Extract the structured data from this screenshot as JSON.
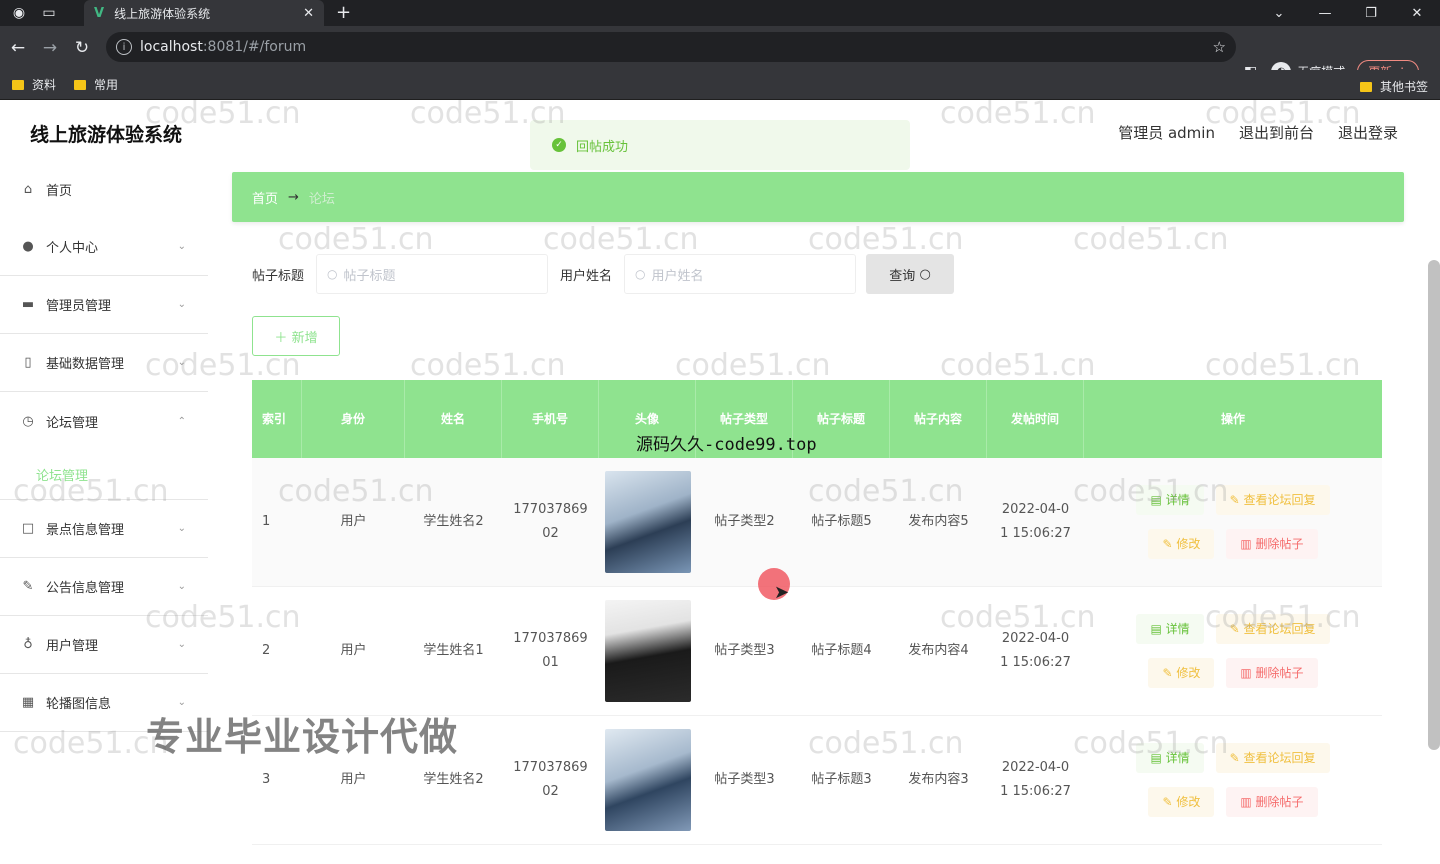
{
  "browser": {
    "tab_title": "线上旅游体验系统",
    "url_host": "localhost",
    "url_rest": ":8081/#/forum",
    "incognito_label": "无痕模式",
    "update_label": "更新",
    "bookmarks": [
      "资料",
      "常用"
    ],
    "other_bookmarks": "其他书签"
  },
  "app": {
    "title": "线上旅游体验系统",
    "user_label": "管理员 admin",
    "back_front": "退出到前台",
    "logout": "退出登录",
    "toast": "回帖成功"
  },
  "sidebar": {
    "items": [
      {
        "label": "首页",
        "icon": "home-icon"
      },
      {
        "label": "个人中心",
        "icon": "user-icon"
      },
      {
        "label": "管理员管理",
        "icon": "admin-icon"
      },
      {
        "label": "基础数据管理",
        "icon": "data-icon"
      },
      {
        "label": "论坛管理",
        "icon": "forum-icon"
      },
      {
        "label": "景点信息管理",
        "icon": "scenic-icon"
      },
      {
        "label": "公告信息管理",
        "icon": "notice-icon"
      },
      {
        "label": "用户管理",
        "icon": "users-icon"
      },
      {
        "label": "轮播图信息",
        "icon": "carousel-icon"
      }
    ],
    "sub_forum": "论坛管理"
  },
  "breadcrumb": {
    "home": "首页",
    "sep": "→",
    "current": "论坛"
  },
  "search": {
    "title_label": "帖子标题",
    "title_placeholder": "帖子标题",
    "user_label": "用户姓名",
    "user_placeholder": "用户姓名",
    "query_button": "查询"
  },
  "add_button": "新增",
  "table": {
    "headers": [
      "索引",
      "身份",
      "姓名",
      "手机号",
      "头像",
      "帖子类型",
      "帖子标题",
      "帖子内容",
      "发帖时间",
      "操作"
    ],
    "rows": [
      {
        "index": "1",
        "role": "用户",
        "name": "学生姓名2",
        "phone": "17703786902",
        "phone_a": "177037869",
        "phone_b": "02",
        "type": "帖子类型2",
        "title": "帖子标题5",
        "content": "发布内容5",
        "time_a": "2022-04-0",
        "time_b": "1 15:06:27"
      },
      {
        "index": "2",
        "role": "用户",
        "name": "学生姓名1",
        "phone": "17703786901",
        "phone_a": "177037869",
        "phone_b": "01",
        "type": "帖子类型3",
        "title": "帖子标题4",
        "content": "发布内容4",
        "time_a": "2022-04-0",
        "time_b": "1 15:06:27"
      },
      {
        "index": "3",
        "role": "用户",
        "name": "学生姓名2",
        "phone": "17703786902",
        "phone_a": "177037869",
        "phone_b": "02",
        "type": "帖子类型3",
        "title": "帖子标题3",
        "content": "发布内容3",
        "time_a": "2022-04-0",
        "time_b": "1 15:06:27"
      }
    ],
    "ops": {
      "detail": "详情",
      "reply": "查看论坛回复",
      "edit": "修改",
      "delete": "删除帖子"
    }
  },
  "overlay": {
    "watermark": "code51.cn",
    "code99": "源码久久-code99.top",
    "promo": "专业毕业设计代做"
  }
}
